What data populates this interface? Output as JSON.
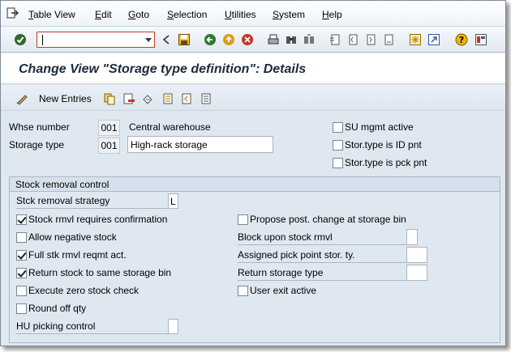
{
  "menubar": {
    "items": [
      {
        "first": "T",
        "rest": "able View"
      },
      {
        "first": "E",
        "rest": "dit"
      },
      {
        "first": "G",
        "rest": "oto"
      },
      {
        "first": "S",
        "rest": "election"
      },
      {
        "first": "U",
        "rest": "tilities"
      },
      {
        "first": "S",
        "rest": "ystem"
      },
      {
        "first": "H",
        "rest": "elp"
      }
    ]
  },
  "toolbar": {
    "command_value": ""
  },
  "title": "Change View \"Storage type definition\": Details",
  "apptoolbar": {
    "new_entries_label": "New Entries"
  },
  "header": {
    "whse_label": "Whse number",
    "whse_value": "001",
    "whse_desc": "Central warehouse",
    "stype_label": "Storage type",
    "stype_value": "001",
    "stype_desc": "High-rack storage",
    "su_mgmt": {
      "label": "SU mgmt active",
      "checked": false
    },
    "id_pnt": {
      "label": "Stor.type is ID pnt",
      "checked": false
    },
    "pck_pnt": {
      "label": "Stor.type is pck pnt",
      "checked": false
    }
  },
  "group": {
    "title": "Stock removal control",
    "strategy_label": "Stck removal strategy",
    "strategy_value": "L",
    "left_checks": [
      {
        "label": "Stock rmvl requires confirmation",
        "checked": true
      },
      {
        "label": "Allow negative stock",
        "checked": false
      },
      {
        "label": "Full stk rmvl reqmt act.",
        "checked": true
      },
      {
        "label": "Return stock to same storage bin",
        "checked": true
      },
      {
        "label": "Execute zero stock check",
        "checked": false
      },
      {
        "label": "Round off qty",
        "checked": false
      }
    ],
    "hu_label": "HU picking control",
    "hu_value": "",
    "propose": {
      "label": "Propose post. change at storage bin",
      "checked": false
    },
    "block_label": "Block upon stock rmvl",
    "block_value": "",
    "assigned_label": "Assigned pick point stor. ty.",
    "assigned_value": "",
    "return_type_label": "Return storage type",
    "return_type_value": "",
    "user_exit": {
      "label": "User exit active",
      "checked": false
    }
  }
}
